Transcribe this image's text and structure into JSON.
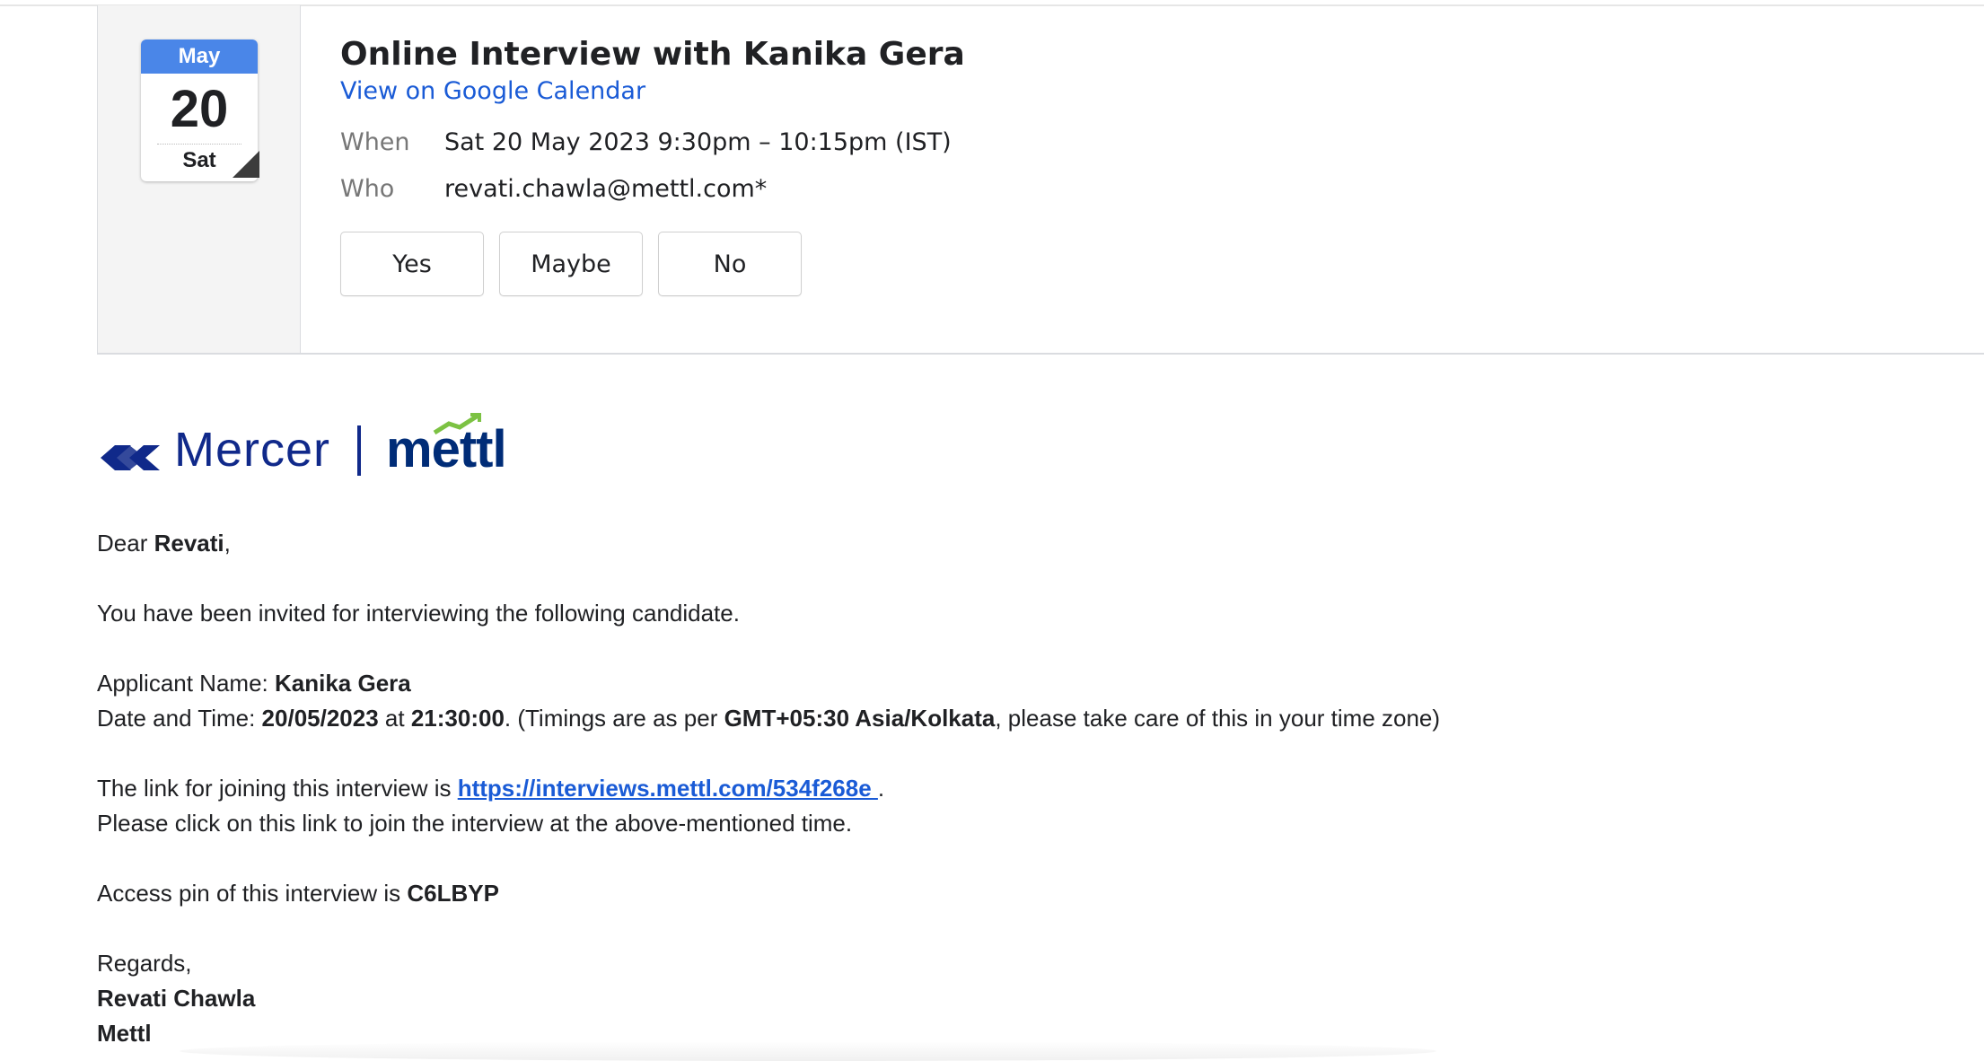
{
  "event": {
    "month": "May",
    "day": "20",
    "weekday": "Sat",
    "title": "Online Interview with Kanika Gera",
    "calendar_link": "View on Google Calendar",
    "when_label": "When",
    "when_value": "Sat 20 May 2023 9:30pm – 10:15pm (IST)",
    "who_label": "Who",
    "who_value": "revati.chawla@mettl.com*",
    "rsvp": {
      "yes": "Yes",
      "maybe": "Maybe",
      "no": "No"
    }
  },
  "logo": {
    "brand1": "Mercer",
    "brand2": "mettl",
    "brand_color": "#10298a",
    "accent_color": "#7cc243"
  },
  "email": {
    "greeting_prefix": "Dear ",
    "recipient": "Revati",
    "greeting_suffix": ",",
    "intro": "You have been invited for interviewing the following candidate.",
    "applicant_label": "Applicant Name: ",
    "applicant_name": "Kanika Gera",
    "datetime_label": "Date and Time: ",
    "date": "20/05/2023",
    "at": " at ",
    "time": "21:30:00",
    "timing_prefix": ". (Timings are as per ",
    "timezone": "GMT+05:30 Asia/Kolkata",
    "timing_suffix": ", please take care of this in your time zone)",
    "link_prefix": "The link for joining this interview is ",
    "link": "https://interviews.mettl.com/534f268e ",
    "link_suffix": ".",
    "link_instruction": "Please click on this link to join the interview at the above-mentioned time.",
    "pin_prefix": "Access pin of this interview is ",
    "pin": "C6LBYP",
    "regards": "Regards,",
    "sender_name": "Revati Chawla",
    "sender_org": "Mettl"
  },
  "colors": {
    "link": "#1a5bd6",
    "calendar_month_bg": "#4a86e8"
  }
}
